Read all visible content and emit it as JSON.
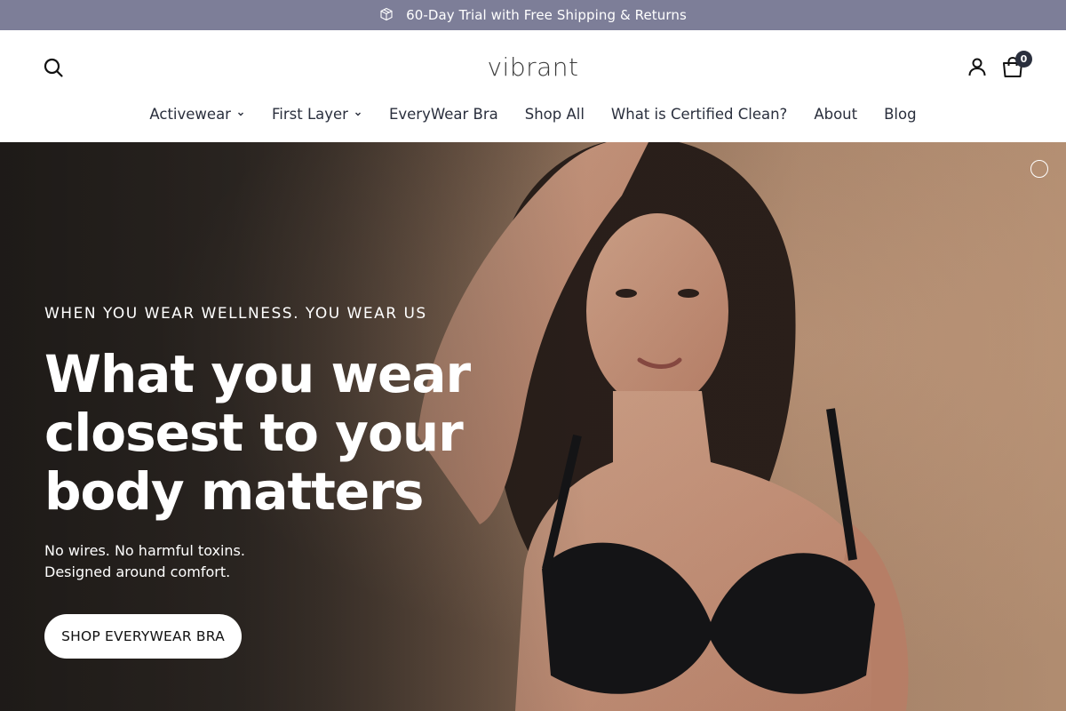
{
  "announcement": {
    "text": "60-Day Trial with Free Shipping & Returns",
    "icon": "package-icon"
  },
  "header": {
    "logo": "vibrant",
    "cart_count": "0",
    "icons": [
      "search-icon",
      "account-icon",
      "cart-icon"
    ]
  },
  "nav": {
    "items": [
      {
        "label": "Activewear",
        "has_dropdown": true
      },
      {
        "label": "First Layer",
        "has_dropdown": true
      },
      {
        "label": "EveryWear Bra",
        "has_dropdown": false
      },
      {
        "label": "Shop All",
        "has_dropdown": false
      },
      {
        "label": "What is Certified Clean?",
        "has_dropdown": false
      },
      {
        "label": "About",
        "has_dropdown": false
      },
      {
        "label": "Blog",
        "has_dropdown": false
      }
    ]
  },
  "hero": {
    "eyebrow": "WHEN YOU WEAR WELLNESS. YOU WEAR US",
    "headline_lines": [
      "What you wear",
      "closest to your",
      "body matters"
    ],
    "subtext_lines": [
      "No wires. No harmful toxins.",
      "Designed around comfort."
    ],
    "cta_label": "SHOP EVERYWEAR BRA"
  },
  "colors": {
    "announcement_bg": "#7d7e98",
    "nav_text": "#2a2f3d",
    "cart_badge": "#2a2f3d",
    "hero_warm": "#b08c70"
  }
}
